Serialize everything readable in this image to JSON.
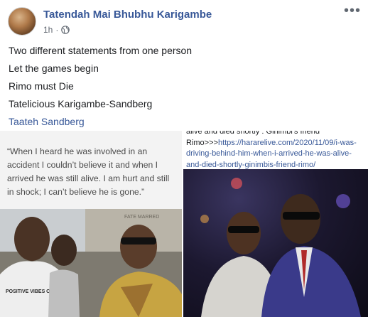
{
  "post": {
    "author": "Tatendah Mai Bhubhu Karigambe",
    "time": "1h",
    "separator": "·",
    "privacy_icon": "globe-icon",
    "more_icon": "more-options-icon",
    "more_label": "•••"
  },
  "lines": {
    "l1": "Two different statements from one person",
    "l2": "Let the games begin",
    "l3": "Rimo must Die",
    "l4": "Tatelicious Karigambe-Sandberg",
    "l5": "Taateh Sandberg"
  },
  "left_image": {
    "quote": "“When I heard he was involved in an accident I couldn’t believe it and when I arrived he was still alive. I am hurt and still in shock; I can’t believe he is gone.”",
    "shirt_text": "POSITIVE VIBES ONLY",
    "sign_text": "FATE MARRED"
  },
  "right_image": {
    "caption_prefix": "alive and died shortly : Ginimbi's friend Rimo>>>",
    "caption_url": "https://hararelive.com/2020/11/09/i-was-driving-behind-him-when-i-arrived-he-was-alive-and-died-shortly-ginimbis-friend-rimo/"
  },
  "colors": {
    "link": "#385898",
    "text": "#1c1e21",
    "meta": "#606770",
    "quote_bg": "#f3f3f3"
  }
}
